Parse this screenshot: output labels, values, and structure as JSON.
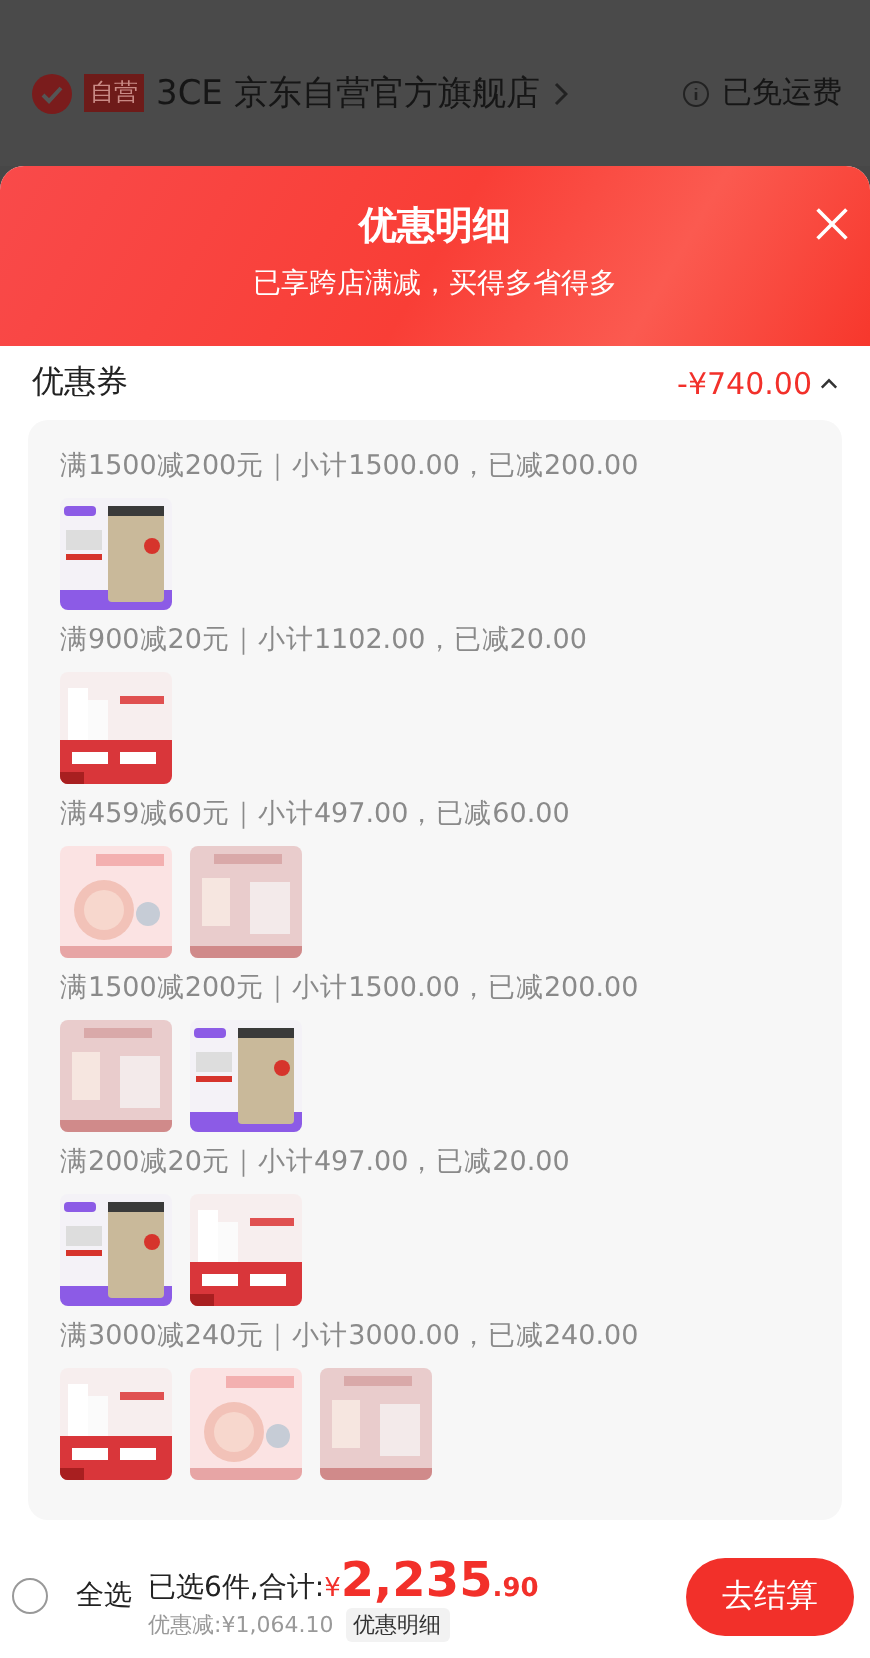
{
  "store_header": {
    "badge": "自营",
    "store_name": "3CE 京东自营官方旗舰店",
    "shipping": "已免运费"
  },
  "popup": {
    "title": "优惠明细",
    "subtitle": "已享跨店满减，买得多省得多"
  },
  "coupon_section": {
    "label": "优惠券",
    "amount": "-¥740.00",
    "expanded": true,
    "groups": [
      {
        "rule": "满1500减200元｜小计1500.00，已减200.00"
      },
      {
        "rule": "满900减20元｜小计1102.00，已减20.00"
      },
      {
        "rule": "满459减60元｜小计497.00，已减60.00"
      },
      {
        "rule": "满1500减200元｜小计1500.00，已减200.00"
      },
      {
        "rule": "满200减20元｜小计497.00，已减20.00"
      },
      {
        "rule": "满3000减240元｜小计3000.00，已减240.00"
      }
    ]
  },
  "bottom_bar": {
    "select_all": {
      "label": "全选",
      "checked": false
    },
    "selected_count": "已选6件,合计:",
    "currency": "¥",
    "total_main": "2,235",
    "total_cents": ".90",
    "discount": "优惠减:¥1,064.10",
    "details_button": "优惠明细",
    "checkout_button": "去结算"
  }
}
